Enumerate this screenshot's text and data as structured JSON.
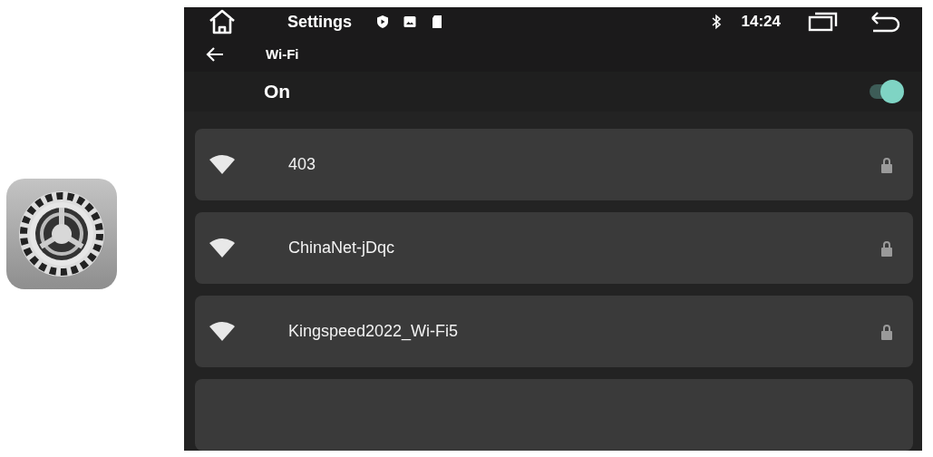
{
  "status_bar": {
    "title": "Settings",
    "time": "14:24"
  },
  "header": {
    "title": "Wi-Fi"
  },
  "wifi_switch": {
    "label": "On",
    "on": true
  },
  "networks": [
    {
      "name": "403",
      "locked": true
    },
    {
      "name": "ChinaNet-jDqc",
      "locked": true
    },
    {
      "name": "Kingspeed2022_Wi-Fi5",
      "locked": true
    }
  ]
}
